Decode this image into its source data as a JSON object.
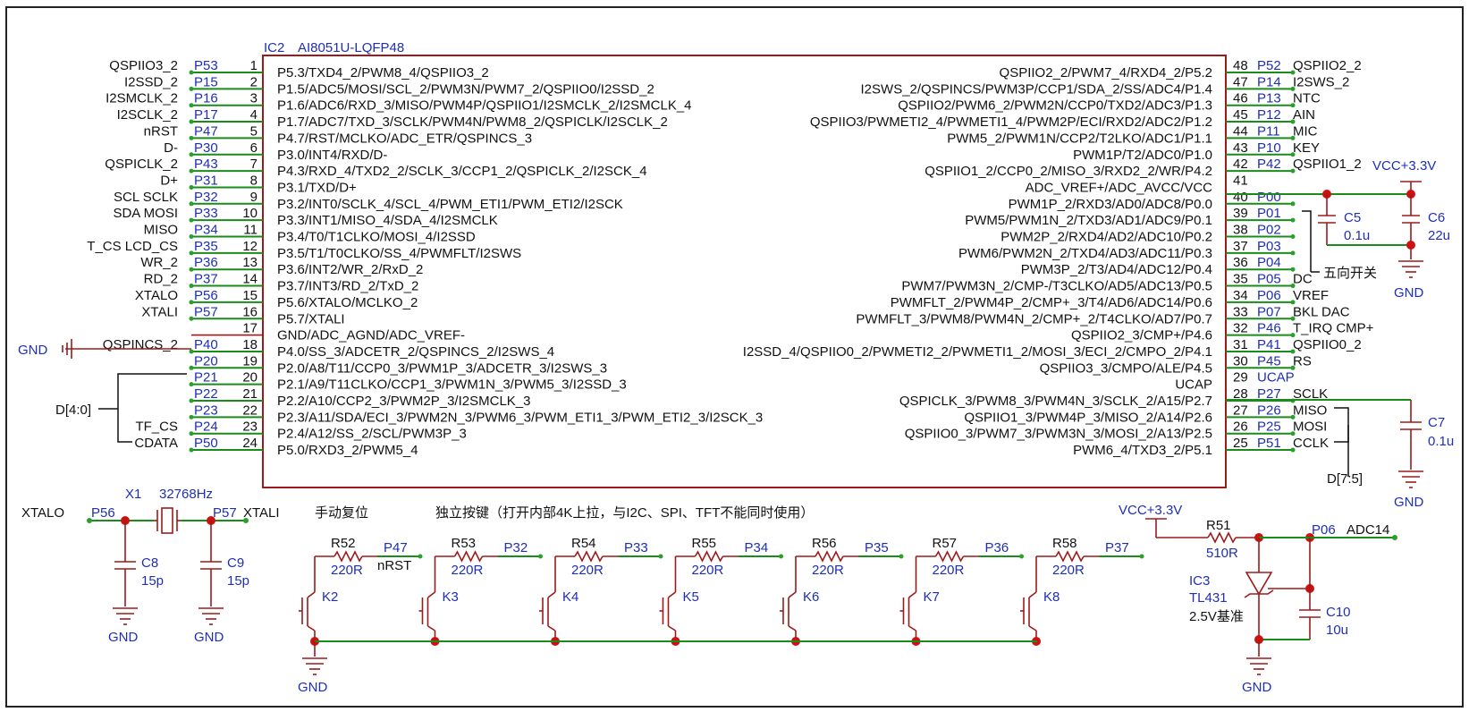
{
  "ic2": {
    "ref": "IC2",
    "part": "AI8051U-LQFP48",
    "left_pins": [
      {
        "num": "1",
        "port": "P53",
        "net": "QSPIIO3_2",
        "func": "P5.3/TXD4_2/PWM8_4/QSPIIO3_2"
      },
      {
        "num": "2",
        "port": "P15",
        "net": "I2SSD_2",
        "func": "P1.5/ADC5/MOSI/SCL_2/PWM3N/PWM7_2/QSPIIO0/I2SSD_2"
      },
      {
        "num": "3",
        "port": "P16",
        "net": "I2SMCLK_2",
        "func": "P1.6/ADC6/RXD_3/MISO/PWM4P/QSPIIO1/I2SMCLK_2/I2SMCLK_4"
      },
      {
        "num": "4",
        "port": "P17",
        "net": "I2SCLK_2",
        "func": "P1.7/ADC7/TXD_3/SCLK/PWM4N/PWM8_2/QSPICLK/I2SCLK_2"
      },
      {
        "num": "5",
        "port": "P47",
        "net": "nRST",
        "func": "P4.7/RST/MCLKO/ADC_ETR/QSPINCS_3"
      },
      {
        "num": "6",
        "port": "P30",
        "net": "D-",
        "func": "P3.0/INT4/RXD/D-"
      },
      {
        "num": "7",
        "port": "P43",
        "net": "QSPICLK_2",
        "func": "P4.3/RXD_4/TXD2_2/SCLK_3/CCP1_2/QSPICLK_2/I2SCK_4"
      },
      {
        "num": "8",
        "port": "P31",
        "net": "D+",
        "func": "P3.1/TXD/D+"
      },
      {
        "num": "9",
        "port": "P32",
        "net": "SCL  SCLK",
        "func": "P3.2/INT0/SCLK_4/SCL_4/PWM_ETI1/PWM_ETI2/I2SCK"
      },
      {
        "num": "10",
        "port": "P33",
        "net": "SDA  MOSI",
        "func": "P3.3/INT1/MISO_4/SDA_4/I2SMCLK"
      },
      {
        "num": "11",
        "port": "P34",
        "net": "MISO",
        "func": "P3.4/T0/T1CLKO/MOSI_4/I2SSD"
      },
      {
        "num": "12",
        "port": "P35",
        "net": "T_CS  LCD_CS",
        "func": "P3.5/T1/T0CLKO/SS_4/PWMFLT/I2SWS"
      },
      {
        "num": "13",
        "port": "P36",
        "net": "WR_2",
        "func": "P3.6/INT2/WR_2/RxD_2"
      },
      {
        "num": "14",
        "port": "P37",
        "net": "RD_2",
        "func": "P3.7/INT3/RD_2/TxD_2"
      },
      {
        "num": "15",
        "port": "P56",
        "net": "XTALO",
        "func": "P5.6/XTALO/MCLKO_2"
      },
      {
        "num": "16",
        "port": "P57",
        "net": "XTALI",
        "func": "P5.7/XTALI"
      },
      {
        "num": "17",
        "port": "",
        "net": "",
        "func": "GND/ADC_AGND/ADC_VREF-"
      },
      {
        "num": "18",
        "port": "P40",
        "net": "QSPINCS_2",
        "func": "P4.0/SS_3/ADCETR_2/QSPINCS_2/I2SWS_4"
      },
      {
        "num": "19",
        "port": "P20",
        "net": "",
        "func": "P2.0/A8/T11/CCP0_3/PWM1P_3/ADCETR_3/I2SWS_3"
      },
      {
        "num": "20",
        "port": "P21",
        "net": "",
        "func": "P2.1/A9/T11CLKO/CCP1_3/PWM1N_3/PWM5_3/I2SSD_3"
      },
      {
        "num": "21",
        "port": "P22",
        "net": "",
        "func": "P2.2/A10/CCP2_3/PWM2P_3/I2SMCLK_3"
      },
      {
        "num": "22",
        "port": "P23",
        "net": "",
        "func": "P2.3/A11/SDA/ECI_3/PWM2N_3/PWM6_3/PWM_ETI1_3/PWM_ETI2_3/I2SCK_3"
      },
      {
        "num": "23",
        "port": "P24",
        "net": "TF_CS",
        "func": "P2.4/A12/SS_2/SCL/PWM3P_3"
      },
      {
        "num": "24",
        "port": "P50",
        "net": "CDATA",
        "func": "P5.0/RXD3_2/PWM5_4"
      }
    ],
    "right_pins": [
      {
        "num": "48",
        "port": "P52",
        "net": "QSPIIO2_2",
        "func": "QSPIIO2_2/PWM7_4/RXD4_2/P5.2"
      },
      {
        "num": "47",
        "port": "P14",
        "net": "I2SWS_2",
        "func": "I2SWS_2/QSPINCS/PWM3P/CCP1/SDA_2/SS/ADC4/P1.4"
      },
      {
        "num": "46",
        "port": "P13",
        "net": "NTC",
        "func": "QSPIIO2/PWM6_2/PWM2N/CCP0/TXD2/ADC3/P1.3"
      },
      {
        "num": "45",
        "port": "P12",
        "net": "AIN",
        "func": "QSPIIO3/PWMETI2_4/PWMETI1_4/PWM2P/ECI/RXD2/ADC2/P1.2"
      },
      {
        "num": "44",
        "port": "P11",
        "net": "MIC",
        "func": "PWM5_2/PWM1N/CCP2/T2LKO/ADC1/P1.1"
      },
      {
        "num": "43",
        "port": "P10",
        "net": "KEY",
        "func": "PWM1P/T2/ADC0/P1.0"
      },
      {
        "num": "42",
        "port": "P42",
        "net": "QSPIIO1_2",
        "func": "QSPIIO1_2/CCP0_2/MISO_3/RXD2_2/WR/P4.2"
      },
      {
        "num": "41",
        "port": "",
        "net": "",
        "func": "ADC_VREF+/ADC_AVCC/VCC"
      },
      {
        "num": "40",
        "port": "P00",
        "net": "",
        "func": "PWM1P_2/RXD3/AD0/ADC8/P0.0"
      },
      {
        "num": "39",
        "port": "P01",
        "net": "",
        "func": "PWM5/PWM1N_2/TXD3/AD1/ADC9/P0.1"
      },
      {
        "num": "38",
        "port": "P02",
        "net": "",
        "func": "PWM2P_2/RXD4/AD2/ADC10/P0.2"
      },
      {
        "num": "37",
        "port": "P03",
        "net": "",
        "func": "PWM6/PWM2N_2/TXD4/AD3/ADC11/P0.3"
      },
      {
        "num": "36",
        "port": "P04",
        "net": "",
        "func": "PWM3P_2/T3/AD4/ADC12/P0.4"
      },
      {
        "num": "35",
        "port": "P05",
        "net": "DC",
        "func": "PWM7/PWM3N_2/CMP-/T3CLKO/AD5/ADC13/P0.5"
      },
      {
        "num": "34",
        "port": "P06",
        "net": "VREF",
        "func": "PWMFLT_2/PWM4P_2/CMP+_3/T4/AD6/ADC14/P0.6"
      },
      {
        "num": "33",
        "port": "P07",
        "net": "BKL     DAC",
        "func": "PWMFLT_3/PWM8/PWM4N_2/CMP+_2/T4CLKO/AD7/P0.7"
      },
      {
        "num": "32",
        "port": "P46",
        "net": "T_IRQ  CMP+",
        "func": "QSPIIO2_3/CMP+/P4.6"
      },
      {
        "num": "31",
        "port": "P41",
        "net": "QSPIIO0_2",
        "func": "I2SSD_4/QSPIIO0_2/PWMETI2_2/PWMETI1_2/MOSI_3/ECI_2/CMPO_2/P4.1"
      },
      {
        "num": "30",
        "port": "P45",
        "net": "RS",
        "func": "QSPIIO3_3/CMPO/ALE/P4.5"
      },
      {
        "num": "29",
        "port": "UCAP",
        "net": "",
        "func": "UCAP"
      },
      {
        "num": "28",
        "port": "P27",
        "net": "SCLK",
        "func": "QSPICLK_3/PWM8_3/PWM4N_3/SCLK_2/A15/P2.7"
      },
      {
        "num": "27",
        "port": "P26",
        "net": "MISO",
        "func": "QSPIIO1_3/PWM4P_3/MISO_2/A14/P2.6"
      },
      {
        "num": "26",
        "port": "P25",
        "net": "MOSI",
        "func": "QSPIIO0_3/PWM7_3/PWM3N_3/MOSI_2/A13/P2.5"
      },
      {
        "num": "25",
        "port": "P51",
        "net": "CCLK",
        "func": "PWM6_4/TXD3_2/P5.1"
      }
    ]
  },
  "nets": {
    "gnd": "GND",
    "vcc": "VCC+3.3V",
    "bus_d40": "D[4:0]",
    "bus_d75": "D[7:5]",
    "five_way": "五向开关"
  },
  "caps": {
    "c5": {
      "ref": "C5",
      "value": "0.1u"
    },
    "c6": {
      "ref": "C6",
      "value": "22u"
    },
    "c7": {
      "ref": "C7",
      "value": "0.1u"
    },
    "c8": {
      "ref": "C8",
      "value": "15p"
    },
    "c9": {
      "ref": "C9",
      "value": "15p"
    },
    "c10": {
      "ref": "C10",
      "value": "10u"
    }
  },
  "crystal": {
    "ref": "X1",
    "freq": "32768Hz",
    "left_net": "XTALO",
    "left_port": "P56",
    "right_port": "P57",
    "right_net": "XTALI"
  },
  "keys": {
    "manual_reset": "手动复位",
    "independent": "独立按键（打开内部4K上拉，与I2C、SPI、TFT不能同时使用）",
    "items": [
      {
        "r": "R52",
        "val": "220R",
        "port": "P47",
        "net": "nRST",
        "k": "K2"
      },
      {
        "r": "R53",
        "val": "220R",
        "port": "P32",
        "net": "",
        "k": "K3"
      },
      {
        "r": "R54",
        "val": "220R",
        "port": "P33",
        "net": "",
        "k": "K4"
      },
      {
        "r": "R55",
        "val": "220R",
        "port": "P34",
        "net": "",
        "k": "K5"
      },
      {
        "r": "R56",
        "val": "220R",
        "port": "P35",
        "net": "",
        "k": "K6"
      },
      {
        "r": "R57",
        "val": "220R",
        "port": "P36",
        "net": "",
        "k": "K7"
      },
      {
        "r": "R58",
        "val": "220R",
        "port": "P37",
        "net": "",
        "k": "K8"
      }
    ]
  },
  "vref": {
    "r": "R51",
    "rval": "510R",
    "port": "P06",
    "net": "ADC14",
    "ic": "IC3",
    "part": "TL431",
    "note": "2.5V基准"
  }
}
